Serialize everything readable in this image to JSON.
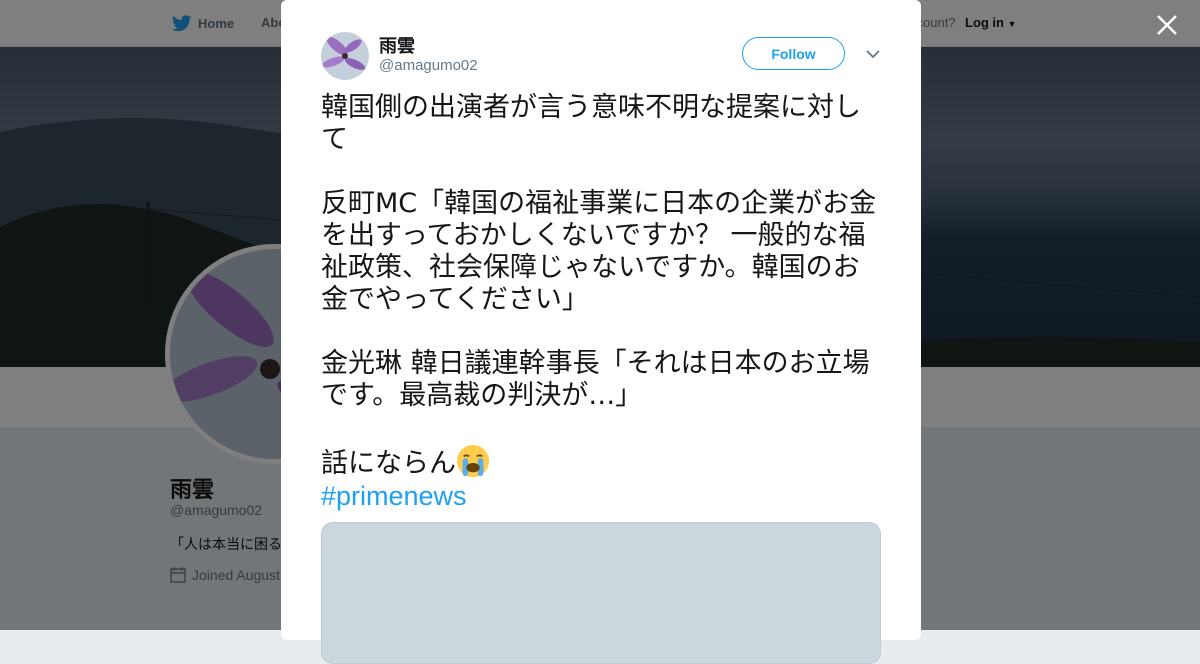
{
  "nav": {
    "home_label": "Home",
    "about_label": "Abo",
    "account_prompt": "ccount?",
    "login_label": "Log in"
  },
  "profile": {
    "name": "雨雲",
    "handle": "@amagumo02",
    "bio": "「人は本当に困る",
    "joined": "Joined August"
  },
  "tweet": {
    "author_name": "雨雲",
    "author_handle": "@amagumo02",
    "follow_label": "Follow",
    "paragraphs": [
      "韓国側の出演者が言う意味不明な提案に対して",
      "反町MC「韓国の福祉事業に日本の企業がお金を出すっておかしくないですか？ 一般的な福祉政策、社会保障じゃないですか。韓国のお金でやってください」",
      "金光琳 韓日議連幹事長「それは日本のお立場です。最高裁の判決が…」",
      "話にならん"
    ],
    "emoji": "loudly-crying-face",
    "hashtag": "#primenews"
  },
  "colors": {
    "accent": "#1da1f2",
    "text": "#14171a",
    "muted": "#657786",
    "media_placeholder": "#ccd6dd"
  },
  "icons": [
    "twitter-bird-icon",
    "close-icon",
    "chevron-down-icon",
    "calendar-icon",
    "dropdown-caret-icon"
  ]
}
